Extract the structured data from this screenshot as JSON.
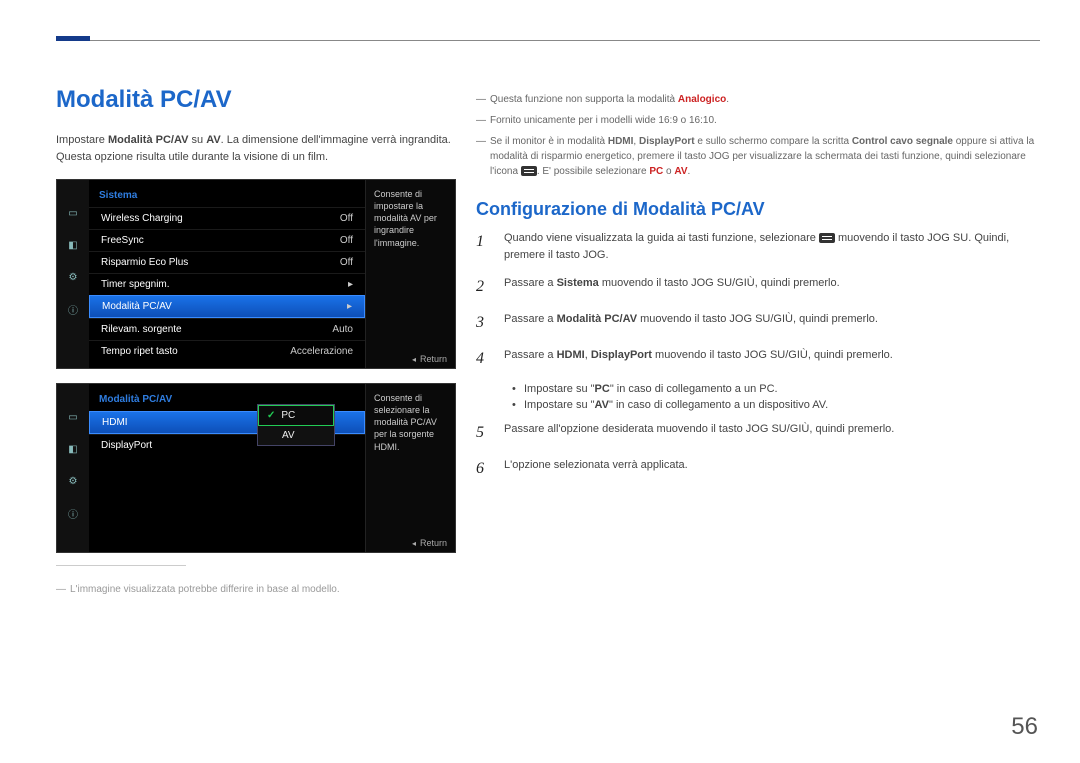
{
  "page_number": "56",
  "heading": "Modalità PC/AV",
  "intro_part1": "Impostare ",
  "intro_bold1": "Modalità PC/AV",
  "intro_part2": " su ",
  "intro_bold2": "AV",
  "intro_part3": ". La dimensione dell'immagine verrà ingrandita.",
  "intro_line2": "Questa opzione risulta utile durante la visione di un film.",
  "osd1": {
    "title": "Sistema",
    "rows": [
      {
        "label": "Wireless Charging",
        "val": "Off"
      },
      {
        "label": "FreeSync",
        "val": "Off"
      },
      {
        "label": "Risparmio Eco Plus",
        "val": "Off"
      },
      {
        "label": "Timer spegnim.",
        "val": "▸"
      },
      {
        "label": "Modalità PC/AV",
        "val": "▸",
        "sel": true
      },
      {
        "label": "Rilevam. sorgente",
        "val": "Auto"
      },
      {
        "label": "Tempo ripet tasto",
        "val": "Accelerazione"
      }
    ],
    "side": "Consente di impostare la modalità AV per ingrandire l'immagine.",
    "return": "Return"
  },
  "osd2": {
    "title": "Modalità PC/AV",
    "rows": [
      {
        "label": "HDMI",
        "val": "",
        "sel": true
      },
      {
        "label": "DisplayPort",
        "val": ""
      }
    ],
    "popup": [
      {
        "label": "PC",
        "sel": true
      },
      {
        "label": "AV"
      }
    ],
    "side": "Consente di selezionare la modalità PC/AV per la sorgente HDMI.",
    "return": "Return"
  },
  "left_note": "L'immagine visualizzata potrebbe differire in base al modello.",
  "right_notes": {
    "n1a": "Questa funzione non supporta la modalità ",
    "n1b": "Analogico",
    "n1c": ".",
    "n2": "Fornito unicamente per i modelli wide 16:9 o 16:10.",
    "n3a": "Se il monitor è in modalità ",
    "n3b": "HDMI",
    "n3c": ", ",
    "n3d": "DisplayPort",
    "n3e": " e sullo schermo compare la scritta ",
    "n3f": "Control cavo segnale",
    "n3g": " oppure si attiva la modalità di risparmio energetico, premere il tasto JOG per visualizzare la schermata dei tasti funzione, quindi selezionare l'icona ",
    "n3h": ". E' possibile selezionare ",
    "n3i": "PC",
    "n3j": " o ",
    "n3k": "AV",
    "n3l": "."
  },
  "subheading": "Configurazione di Modalità PC/AV",
  "steps": {
    "s1a": "Quando viene visualizzata la guida ai tasti funzione, selezionare ",
    "s1b": " muovendo il tasto JOG SU. Quindi, premere il tasto JOG.",
    "s2a": "Passare a ",
    "s2b": "Sistema",
    "s2c": " muovendo il tasto JOG SU/GIÙ, quindi premerlo.",
    "s3a": "Passare a ",
    "s3b": "Modalità PC/AV",
    "s3c": " muovendo il tasto JOG SU/GIÙ, quindi premerlo.",
    "s4a": "Passare a ",
    "s4b": "HDMI",
    "s4c": ", ",
    "s4d": "DisplayPort",
    "s4e": " muovendo il tasto JOG SU/GIÙ, quindi premerlo.",
    "b1a": "Impostare su \"",
    "b1b": "PC",
    "b1c": "\" in caso di collegamento a un PC.",
    "b2a": "Impostare su \"",
    "b2b": "AV",
    "b2c": "\" in caso di collegamento a un dispositivo AV.",
    "s5": "Passare all'opzione desiderata muovendo il tasto JOG SU/GIÙ, quindi premerlo.",
    "s6": "L'opzione selezionata verrà applicata."
  }
}
